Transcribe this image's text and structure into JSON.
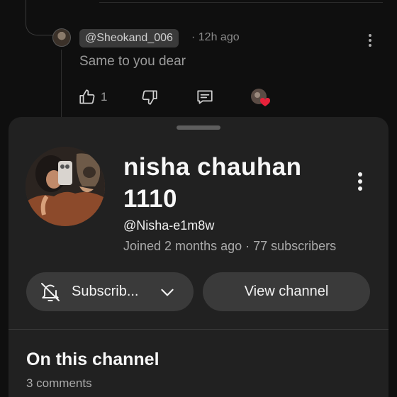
{
  "comment": {
    "handle": "@Sheokand_006",
    "time": "· 12h ago",
    "text": "Same to you dear",
    "like_count": "1"
  },
  "channel_sheet": {
    "name": "nisha chauhan 1110",
    "handle": "@Nisha-e1m8w",
    "meta": "Joined 2 months ago · 77 subscribers",
    "subscribe_label": "Subscrib...",
    "view_channel_label": "View channel",
    "section_title": "On this channel",
    "section_count": "3 comments"
  },
  "icons": {
    "like": "thumbs-up-icon",
    "dislike": "thumbs-down-icon",
    "reply": "reply-icon",
    "creator_heart": "creator-heart-icon",
    "bell": "bell-off-icon",
    "chevron": "chevron-down-icon"
  },
  "colors": {
    "background": "#0f0f0f",
    "sheet": "#212121",
    "button": "#3a3a3a",
    "heart": "#e8213a"
  }
}
